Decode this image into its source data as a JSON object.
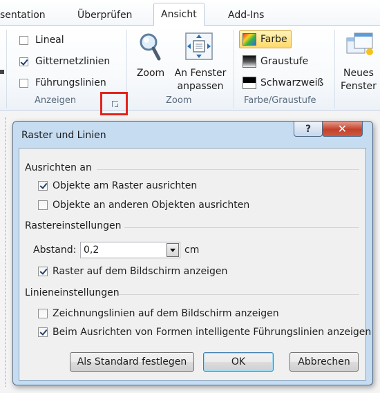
{
  "ribbon": {
    "tabs": [
      {
        "label": "sentation"
      },
      {
        "label": "Überprüfen"
      },
      {
        "label": "Ansicht",
        "active": true
      },
      {
        "label": "Add-Ins"
      }
    ],
    "anzeigen": {
      "items": [
        {
          "label": "Lineal",
          "checked": false
        },
        {
          "label": "Gitternetzlinien",
          "checked": true
        },
        {
          "label": "Führungslinien",
          "checked": false
        }
      ],
      "group_label": "Anzeigen"
    },
    "zoom": {
      "zoom_label": "Zoom",
      "fit_label_line1": "An Fenster",
      "fit_label_line2": "anpassen",
      "group_label": "Zoom"
    },
    "color": {
      "items": [
        {
          "label": "Farbe",
          "selected": true
        },
        {
          "label": "Graustufe"
        },
        {
          "label": "Schwarzweiß"
        }
      ],
      "group_label": "Farbe/Graustufe"
    },
    "window": {
      "new_label_line1": "Neues",
      "new_label_line2": "Fenster"
    }
  },
  "dialog": {
    "title": "Raster und Linien",
    "help_glyph": "?",
    "close_glyph": "✕",
    "snap": {
      "title": "Ausrichten an",
      "options": [
        {
          "label": "Objekte am Raster ausrichten",
          "checked": true
        },
        {
          "label": "Objekte an anderen Objekten ausrichten",
          "checked": false
        }
      ]
    },
    "grid": {
      "title": "Rastereinstellungen",
      "spacing_label": "Abstand:",
      "spacing_value": "0,2",
      "unit": "cm",
      "show_grid": {
        "label": "Raster auf dem Bildschirm anzeigen",
        "checked": true
      }
    },
    "guides": {
      "title": "Linieneinstellungen",
      "options": [
        {
          "label": "Zeichnungslinien auf dem Bildschirm anzeigen",
          "checked": false
        },
        {
          "label": "Beim Ausrichten von Formen intelligente Führungslinien anzeigen",
          "checked": true
        }
      ]
    },
    "buttons": {
      "set_default": "Als Standard festlegen",
      "ok": "OK",
      "cancel": "Abbrechen"
    }
  },
  "colors": {
    "highlight_box": "#e3231c",
    "selected_item_bg": "#ffe27a",
    "dialog_frame": "#c6dcf1",
    "close_button": "#c3412b"
  }
}
